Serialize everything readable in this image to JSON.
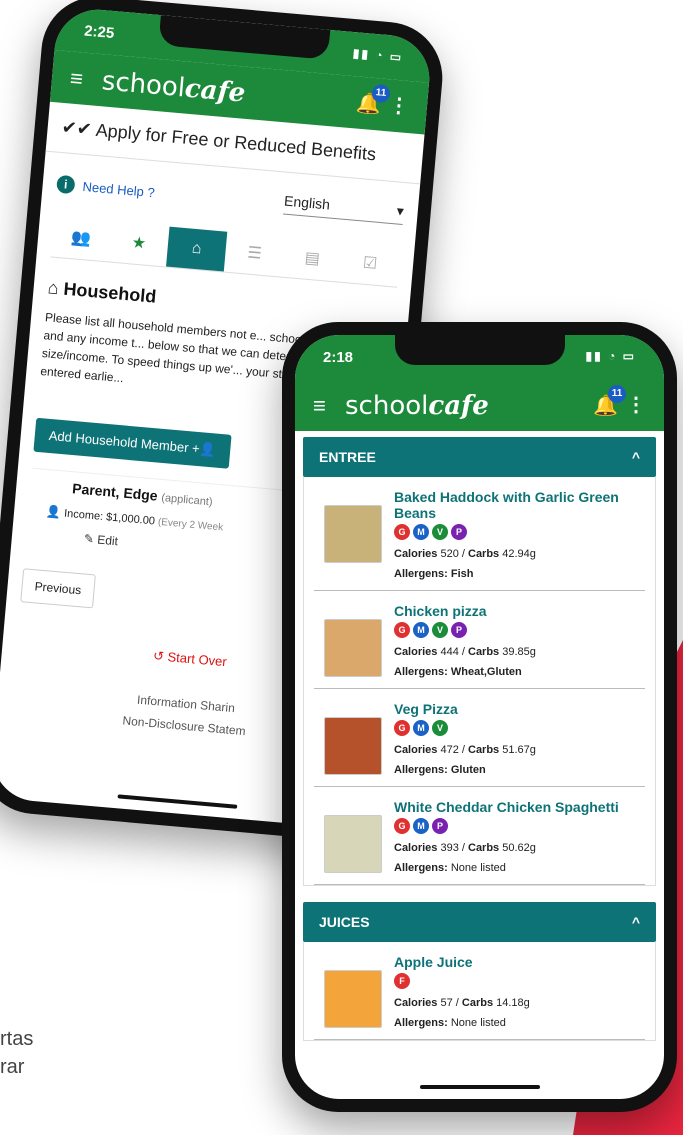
{
  "background_text": [
    "rtas",
    "rar"
  ],
  "colors": {
    "header_green": "#1d8a3b",
    "teal": "#0e7377",
    "accent_red": "#e8253f"
  },
  "back_phone": {
    "status_time": "2:25",
    "brand_prefix": "school",
    "brand_suffix": "cafe",
    "notification_count": "11",
    "page_title": "Apply for Free or Reduced Benefits",
    "help_label": "Need Help ?",
    "language": "English",
    "section_title": "Household",
    "description": "Please list all household members not e... school district here] and any income t... below so that we can determine your... size/income. To speed things up we'... your students that you entered earlie...",
    "add_member_label": "Add Household Member",
    "member": {
      "name": "Parent, Edge",
      "role": "(applicant)",
      "income": "Income: $1,000.00",
      "frequency": "(Every 2 Week",
      "edit_label": "Edit"
    },
    "previous_label": "Previous",
    "start_over_label": "Start Over",
    "footer_links": [
      "Information Sharin",
      "Non-Disclosure Statem"
    ]
  },
  "front_phone": {
    "status_time": "2:18",
    "brand_prefix": "school",
    "brand_suffix": "cafe",
    "notification_count": "11",
    "categories": [
      {
        "name": "ENTREE",
        "items": [
          {
            "name": "Baked Haddock with Garlic Green Beans",
            "badges": [
              "G",
              "M",
              "V",
              "P"
            ],
            "calories": "520",
            "carbs": "42.94g",
            "allergens": "Fish",
            "img_color": "#c9b27a"
          },
          {
            "name": "Chicken pizza",
            "badges": [
              "G",
              "M",
              "V",
              "P"
            ],
            "calories": "444",
            "carbs": "39.85g",
            "allergens": "Wheat,Gluten",
            "img_color": "#d9a86a"
          },
          {
            "name": "Veg Pizza",
            "badges": [
              "G",
              "M",
              "V"
            ],
            "calories": "472",
            "carbs": "51.67g",
            "allergens": "Gluten",
            "img_color": "#b5522c"
          },
          {
            "name": "White Cheddar Chicken Spaghetti",
            "badges": [
              "G",
              "M",
              "P"
            ],
            "calories": "393",
            "carbs": "50.62g",
            "allergens": "None listed",
            "img_color": "#d8d6b8"
          }
        ]
      },
      {
        "name": "JUICES",
        "items": [
          {
            "name": "Apple Juice",
            "badges": [
              "F"
            ],
            "calories": "57",
            "carbs": "14.18g",
            "allergens": "None listed",
            "img_color": "#f3a43a"
          }
        ]
      }
    ],
    "labels": {
      "calories": "Calories",
      "carbs": "Carbs",
      "allergens": "Allergens:"
    }
  }
}
